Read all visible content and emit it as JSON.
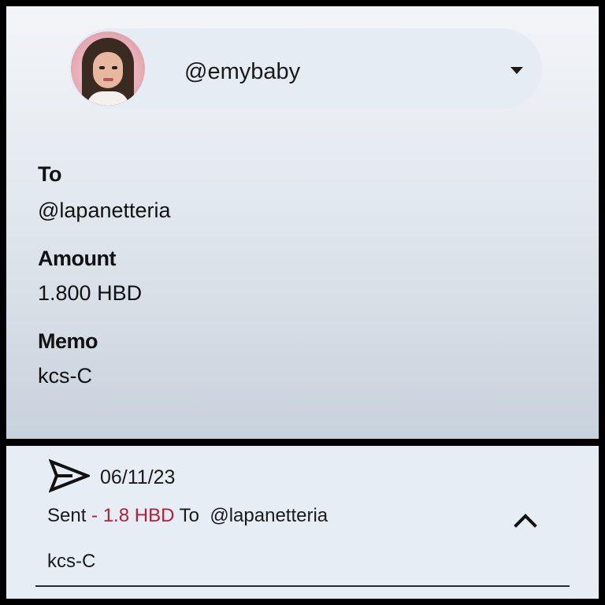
{
  "account": {
    "name": "@emybaby"
  },
  "transfer": {
    "to_label": "To",
    "to_value": "@lapanetteria",
    "amount_label": "Amount",
    "amount_value": "1.800 HBD",
    "memo_label": "Memo",
    "memo_value": "kcs-C"
  },
  "history": {
    "date": "06/11/23",
    "action": "Sent",
    "amount": "- 1.8 HBD",
    "to_word": "To",
    "recipient": "@lapanetteria",
    "memo": "kcs-C"
  },
  "icons": {
    "dropdown": "caret-down-icon",
    "sent": "send-icon",
    "collapse": "chevron-up-icon"
  },
  "colors": {
    "amount_negative": "#b0203a"
  }
}
